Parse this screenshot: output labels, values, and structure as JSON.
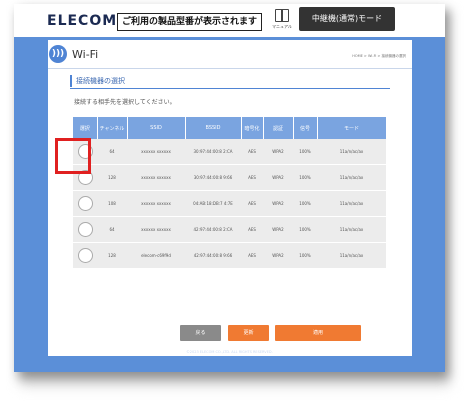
{
  "header": {
    "logo": "ELECOM",
    "model_notice": "ご利用の製品型番が表示されます",
    "manual_label": "マニュアル",
    "mode_button": "中継機(通常)モード"
  },
  "page": {
    "icon": "wifi-icon",
    "title": "Wi-Fi",
    "breadcrumb": "HOME > Wi-Fi > 接続機器の選択"
  },
  "section": {
    "heading": "接続機器の選択",
    "instruction": "接続する相手先を選択してください。"
  },
  "table": {
    "headers": [
      "選択",
      "チャンネル",
      "SSID",
      "BSSID",
      "暗号化",
      "認証",
      "信号",
      "モード"
    ],
    "rows": [
      {
        "channel": "64",
        "ssid": "xxxxxx  xxxxxx",
        "bssid": "30:97:44:00:8 2:CA",
        "encryption": "AES",
        "auth": "WPA2",
        "signal": "100%",
        "mode": "11a/n/ac/ax"
      },
      {
        "channel": "128",
        "ssid": "xxxxxx  xxxxxx",
        "bssid": "30:97:44:00:8 9:66",
        "encryption": "AES",
        "auth": "WPA2",
        "signal": "100%",
        "mode": "11a/n/ac/ax"
      },
      {
        "channel": "108",
        "ssid": "xxxxxx  xxxxxx",
        "bssid": "04:AB:18:DB:7 4:7E",
        "encryption": "AES",
        "auth": "WPA2",
        "signal": "100%",
        "mode": "11a/n/ac/ax"
      },
      {
        "channel": "64",
        "ssid": "xxxxxx  xxxxxx",
        "bssid": "42:97:44:00:8 2:CA",
        "encryption": "AES",
        "auth": "WPA2",
        "signal": "100%",
        "mode": "11a/n/ac/ax"
      },
      {
        "channel": "128",
        "ssid": "elecom-c69f9d",
        "bssid": "42:97:44:00:8 9:66",
        "encryption": "AES",
        "auth": "WPA2",
        "signal": "100%",
        "mode": "11a/n/ac/ax"
      }
    ]
  },
  "buttons": {
    "back": "戻る",
    "refresh": "更新",
    "apply": "適用"
  },
  "footer": "©2023 ELECOM CO.,LTD. ALL RIGHTS RESERVED.",
  "colors": {
    "page_background": "#5b8fd8",
    "accent": "#4f84d4",
    "table_header": "#7aa4e0",
    "button_orange": "#f07a32",
    "button_gray": "#8a8a8a",
    "highlight": "#e02020"
  }
}
